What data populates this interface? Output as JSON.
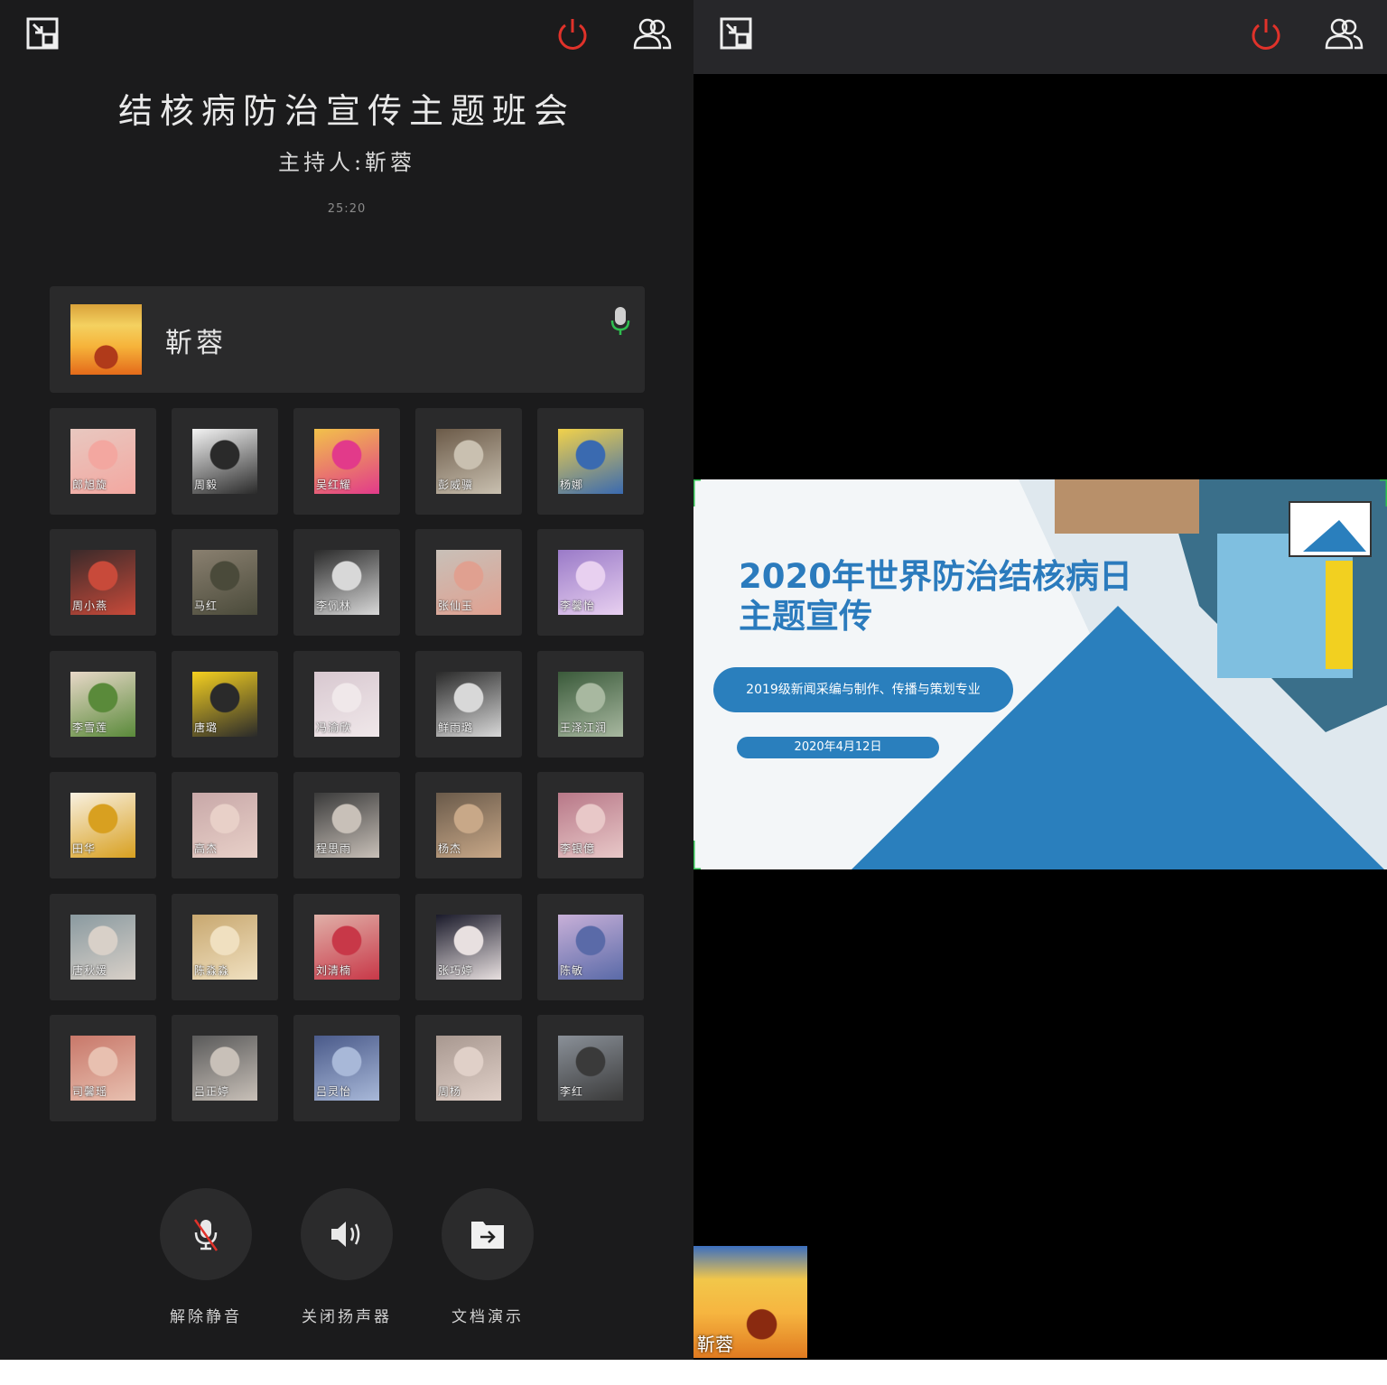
{
  "meeting": {
    "title": "结核病防治宣传主题班会",
    "host_label": "主持人:靳蓉",
    "timer": "25:20"
  },
  "host": {
    "name": "靳蓉"
  },
  "participants": [
    {
      "name": "郎旭旋",
      "c1": "#e8c8c0",
      "c2": "#f3a7a0"
    },
    {
      "name": "周毅",
      "c1": "#f4f4f4",
      "c2": "#2a2a2a"
    },
    {
      "name": "吴红耀",
      "c1": "#f2c24a",
      "c2": "#e23a8a"
    },
    {
      "name": "彭威骥",
      "c1": "#6b5a48",
      "c2": "#c9c0b0"
    },
    {
      "name": "杨娜",
      "c1": "#f2d24a",
      "c2": "#3a6ab0"
    },
    {
      "name": "周小燕",
      "c1": "#3a2a2a",
      "c2": "#c84a3a"
    },
    {
      "name": "马红",
      "c1": "#8a8070",
      "c2": "#4a4a3a"
    },
    {
      "name": "李佩林",
      "c1": "#2a2a2a",
      "c2": "#d8d8d8"
    },
    {
      "name": "张仙玉",
      "c1": "#c8c0b8",
      "c2": "#e0a090"
    },
    {
      "name": "李馨怡",
      "c1": "#9a7ac8",
      "c2": "#e8d0f0"
    },
    {
      "name": "李雪莲",
      "c1": "#e8d8c8",
      "c2": "#5a8a3a"
    },
    {
      "name": "唐璐",
      "c1": "#f5d020",
      "c2": "#2a2a2a"
    },
    {
      "name": "冯渝欣",
      "c1": "#d8c8d0",
      "c2": "#f0e8ea"
    },
    {
      "name": "鲜雨璐",
      "c1": "#2a2a2a",
      "c2": "#d8d8d8"
    },
    {
      "name": "王泽江润",
      "c1": "#3a5a3a",
      "c2": "#a8b8a0"
    },
    {
      "name": "田华",
      "c1": "#f8f0e0",
      "c2": "#d8a020"
    },
    {
      "name": "高杰",
      "c1": "#c8a8a8",
      "c2": "#e8d0c8"
    },
    {
      "name": "程思雨",
      "c1": "#3a3a3a",
      "c2": "#c8c0b8"
    },
    {
      "name": "杨杰",
      "c1": "#6a5a4a",
      "c2": "#c8a888"
    },
    {
      "name": "李银億",
      "c1": "#b87888",
      "c2": "#e8c8c8"
    },
    {
      "name": "唐秋媛",
      "c1": "#8a9aa0",
      "c2": "#d8d0c8"
    },
    {
      "name": "陈淼淼",
      "c1": "#c8a870",
      "c2": "#f0e0c0"
    },
    {
      "name": "刘清楠",
      "c1": "#e0b0a8",
      "c2": "#c83848"
    },
    {
      "name": "张巧婷",
      "c1": "#1a1a2a",
      "c2": "#e8e0e0"
    },
    {
      "name": "陈敏",
      "c1": "#c8b0d8",
      "c2": "#5a6aa8"
    },
    {
      "name": "司馨瑶",
      "c1": "#c8786a",
      "c2": "#e8c0b0"
    },
    {
      "name": "吕正婷",
      "c1": "#5a5a5a",
      "c2": "#c8c0b8"
    },
    {
      "name": "吕灵怡",
      "c1": "#4a5a8a",
      "c2": "#a8b8d8"
    },
    {
      "name": "周杨",
      "c1": "#a89890",
      "c2": "#e0d0c8"
    },
    {
      "name": "李红",
      "c1": "#8a9098",
      "c2": "#3a3a3a"
    }
  ],
  "controls": [
    {
      "label": "解除静音",
      "icon": "mic-muted-icon"
    },
    {
      "label": "关闭扬声器",
      "icon": "speaker-icon"
    },
    {
      "label": "文档演示",
      "icon": "folder-share-icon"
    }
  ],
  "slide": {
    "title": "2020年世界防治结核病日主题宣传",
    "subtitle": "2019级新闻采编与制作、传播与策划专业",
    "date": "2020年4月12日"
  },
  "self_view": {
    "name": "靳蓉"
  },
  "colors": {
    "accent_red": "#e0322a",
    "mic_green": "#2fbf4f",
    "slide_blue": "#2a7fbd"
  }
}
